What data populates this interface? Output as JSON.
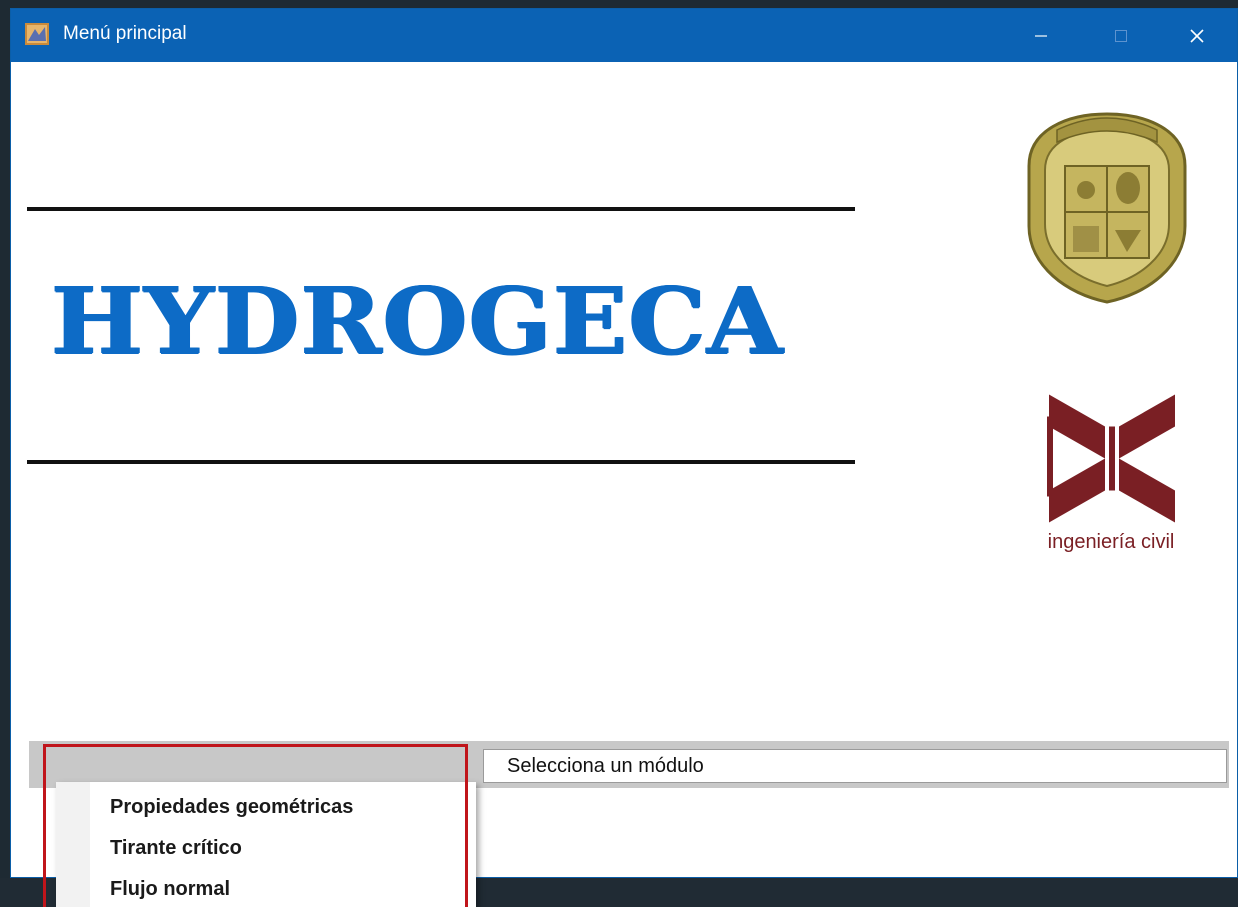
{
  "window": {
    "title": "Menú principal",
    "title_bar_color": "#0b62b4",
    "controls": [
      "minimize-icon",
      "maximize-icon",
      "close-icon"
    ]
  },
  "main": {
    "app_name": "HYDROGECA",
    "app_name_color": "#0d6bc6",
    "logos": [
      "university-seal",
      "ingenieria-civil-logo"
    ],
    "ic_logo_label": "ingeniería civil",
    "ic_logo_color": "#7a1f24"
  },
  "module_selector": {
    "selected_label": "Selecciona un módulo",
    "options": [
      "Propiedades geométricas",
      "Tirante crítico",
      "Flujo normal"
    ]
  },
  "annotation": {
    "highlight_color": "#c0151b"
  }
}
